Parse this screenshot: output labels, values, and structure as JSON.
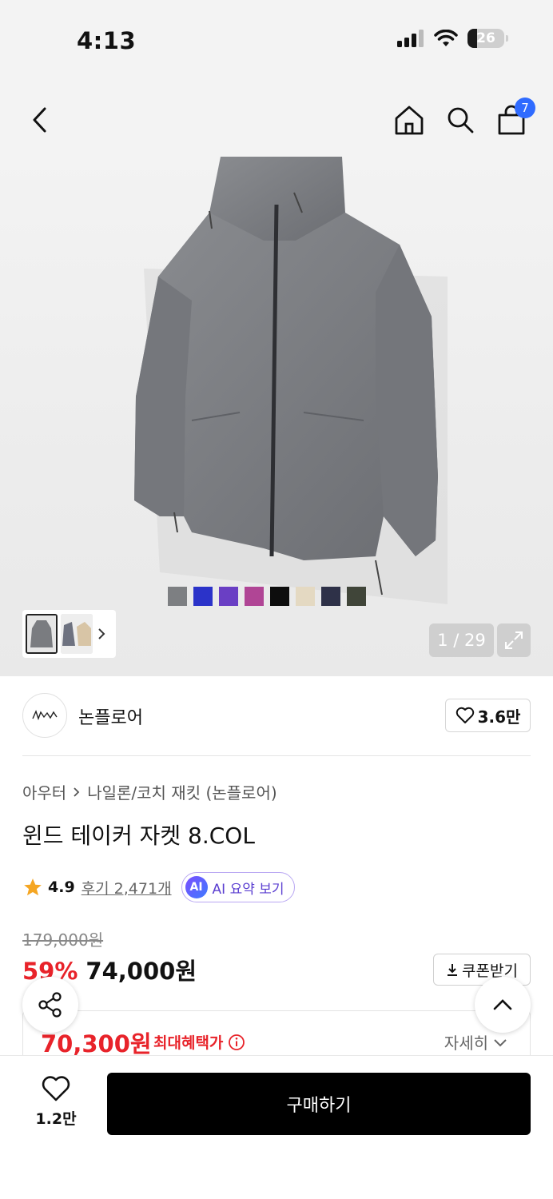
{
  "status": {
    "time": "4:13",
    "battery": "26"
  },
  "nav": {
    "cart_count": "7"
  },
  "gallery": {
    "swatch_colors": [
      "#7d7f82",
      "#2b33c9",
      "#6a3fc4",
      "#b04595",
      "#0d0d0d",
      "#e4d9c2",
      "#2e3148",
      "#404539"
    ],
    "counter": "1 / 29"
  },
  "brand": {
    "name": "논플로어",
    "likes": "3.6만"
  },
  "breadcrumb": {
    "category": "아우터",
    "subcategory": "나일론/코치 재킷 (논플로어)"
  },
  "product": {
    "name": "윈드 테이커 자켓 8.COL"
  },
  "rating": {
    "score": "4.9",
    "reviews": "후기 2,471개",
    "ai_badge": "AI",
    "ai_summary": "AI 요약 보기"
  },
  "price": {
    "original": "179,000원",
    "discount": "59%",
    "sale": "74,000원",
    "coupon": "쿠폰받기",
    "max_benefit_price": "70,300원",
    "max_benefit_label": "최대혜택가",
    "details": "자세히"
  },
  "bottom": {
    "wish_count": "1.2만",
    "buy": "구매하기"
  }
}
